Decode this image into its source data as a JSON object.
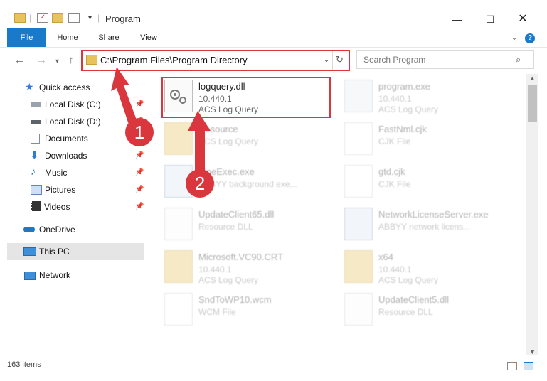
{
  "window": {
    "title": "Program",
    "minimize_icon": "minimize-icon",
    "maximize_icon": "maximize-icon",
    "close_icon": "close-icon"
  },
  "ribbon": {
    "tabs": [
      "File",
      "Home",
      "Share",
      "View"
    ]
  },
  "navigation": {
    "address": "C:\\Program Files\\Program Directory",
    "search_placeholder": "Search Program"
  },
  "sidebar": {
    "items": [
      {
        "label": "Quick access",
        "icon": "star-icon"
      },
      {
        "label": "Local Disk (C:)",
        "icon": "drive-icon",
        "pinned": true
      },
      {
        "label": "Local Disk (D:)",
        "icon": "drive-icon",
        "pinned": true
      },
      {
        "label": "Documents",
        "icon": "documents-icon",
        "pinned": true
      },
      {
        "label": "Downloads",
        "icon": "download-icon",
        "pinned": true
      },
      {
        "label": "Music",
        "icon": "music-icon",
        "pinned": true
      },
      {
        "label": "Pictures",
        "icon": "pictures-icon",
        "pinned": true
      },
      {
        "label": "Videos",
        "icon": "video-icon",
        "pinned": true
      },
      {
        "label": "OneDrive",
        "icon": "cloud-icon"
      },
      {
        "label": "This PC",
        "icon": "computer-icon",
        "selected": true
      },
      {
        "label": "Network",
        "icon": "network-icon"
      }
    ]
  },
  "files": [
    {
      "name": "logquery.dll",
      "line2": "10.440.1",
      "line3": "ACS Log Query",
      "icon": "dll-gear-icon",
      "highlighted": true
    },
    {
      "name": "program.exe",
      "line2": "10.440.1",
      "line3": "ACS Log Query",
      "icon": "exe-icon"
    },
    {
      "name": "Resource",
      "line2": "ACS Log Query",
      "line3": "",
      "icon": "folder-icon"
    },
    {
      "name": "FastNml.cjk",
      "line2": "CJK File",
      "line3": "",
      "icon": "file-icon"
    },
    {
      "name": "FineExec.exe",
      "line2": "ABBYY background exe...",
      "line3": "",
      "icon": "exe-icon"
    },
    {
      "name": "gtd.cjk",
      "line2": "CJK File",
      "line3": "",
      "icon": "file-icon"
    },
    {
      "name": "UpdateClient65.dll",
      "line2": "Resource DLL",
      "line3": "",
      "icon": "dll-gear-icon"
    },
    {
      "name": "NetworkLicenseServer.exe",
      "line2": "ABBYY network licens...",
      "line3": "",
      "icon": "exe-icon"
    },
    {
      "name": "Microsoft.VC90.CRT",
      "line2": "10.440.1",
      "line3": "ACS Log Query",
      "icon": "folder-icon"
    },
    {
      "name": "x64",
      "line2": "10.440.1",
      "line3": "ACS Log Query",
      "icon": "folder-icon"
    },
    {
      "name": "SndToWP10.wcm",
      "line2": "WCM File",
      "line3": "",
      "icon": "file-icon"
    },
    {
      "name": "UpdateClient5.dll",
      "line2": "Resource DLL",
      "line3": "",
      "icon": "dll-gear-icon"
    }
  ],
  "annotations": {
    "step1": "1",
    "step2": "2",
    "color": "#d9363e"
  },
  "status": {
    "item_count": "163 items"
  },
  "colors": {
    "accent": "#1979ca",
    "selection": "#e5e5e5"
  }
}
